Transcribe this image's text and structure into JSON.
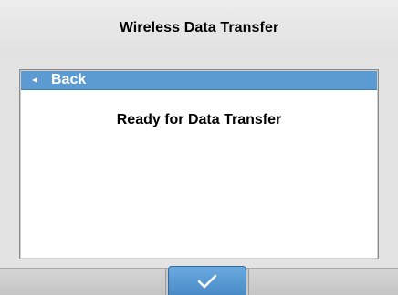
{
  "header": {
    "title": "Wireless Data Transfer"
  },
  "nav": {
    "back_label": "Back",
    "back_icon": "back-arrow-icon"
  },
  "main": {
    "message": "Ready for Data Transfer"
  },
  "footer": {
    "ok_icon": "checkmark-icon"
  },
  "colors": {
    "accent": "#5b9bd1",
    "background": "#e3e3e3",
    "panel": "#ffffff"
  }
}
